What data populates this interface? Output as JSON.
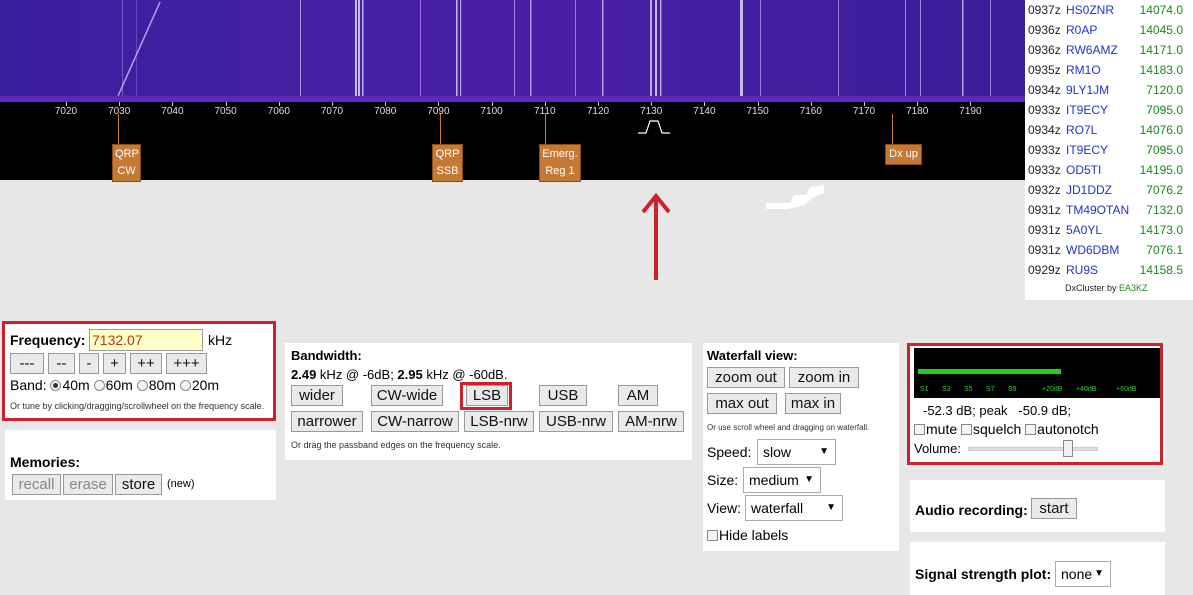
{
  "scale": {
    "ticks": [
      "7020",
      "7030",
      "7040",
      "7050",
      "7060",
      "7070",
      "7080",
      "7090",
      "7100",
      "7110",
      "7120",
      "7130",
      "7140",
      "7150",
      "7160",
      "7170",
      "7180",
      "7190"
    ],
    "labels": [
      {
        "line1": "QRP",
        "line2": "CW"
      },
      {
        "line1": "QRP",
        "line2": "SSB"
      },
      {
        "line1": "Emerg.",
        "line2": "Reg 1"
      },
      {
        "line1": "Dx up",
        "line2": ""
      }
    ]
  },
  "dxcluster": {
    "rows": [
      {
        "time": "0937z",
        "call": "HS0ZNR",
        "freq": "14074.0"
      },
      {
        "time": "0936z",
        "call": "R0AP",
        "freq": "14045.0"
      },
      {
        "time": "0936z",
        "call": "RW6AMZ",
        "freq": "14171.0"
      },
      {
        "time": "0935z",
        "call": "RM1O",
        "freq": "14183.0"
      },
      {
        "time": "0934z",
        "call": "9LY1JM",
        "freq": "7120.0"
      },
      {
        "time": "0933z",
        "call": "IT9ECY",
        "freq": "7095.0"
      },
      {
        "time": "0934z",
        "call": "RO7L",
        "freq": "14076.0"
      },
      {
        "time": "0933z",
        "call": "IT9ECY",
        "freq": "7095.0"
      },
      {
        "time": "0933z",
        "call": "OD5TI",
        "freq": "14195.0"
      },
      {
        "time": "0932z",
        "call": "JD1DDZ",
        "freq": "7076.2"
      },
      {
        "time": "0931z",
        "call": "TM49OTAN",
        "freq": "7132.0"
      },
      {
        "time": "0931z",
        "call": "5A0YL",
        "freq": "14173.0"
      },
      {
        "time": "0931z",
        "call": "WD6DBM",
        "freq": "7076.1"
      },
      {
        "time": "0929z",
        "call": "RU9S",
        "freq": "14158.5"
      }
    ],
    "footer_prefix": "DxCluster by ",
    "footer_link": "EA3KZ"
  },
  "frequency": {
    "label": "Frequency:",
    "value": "7132.07",
    "unit": "kHz",
    "step_buttons": [
      "---",
      "--",
      "-",
      "+",
      "++",
      "+++"
    ],
    "band_label": "Band:",
    "bands": [
      "40m",
      "60m",
      "80m",
      "20m"
    ],
    "selected_band": "40m",
    "hint": "Or tune by clicking/dragging/scrollwheel on the frequency scale."
  },
  "memories": {
    "label": "Memories:",
    "recall": "recall",
    "erase": "erase",
    "store": "store",
    "new": "(new)"
  },
  "bandwidth": {
    "label": "Bandwidth:",
    "bw1": "2.49",
    "bw1_text": " kHz @ -6dB; ",
    "bw2": "2.95",
    "bw2_text": " kHz @ -60dB.",
    "row1": [
      "wider",
      "CW-wide",
      "LSB",
      "USB",
      "AM"
    ],
    "row2": [
      "narrower",
      "CW-narrow",
      "LSB-nrw",
      "USB-nrw",
      "AM-nrw"
    ],
    "hint": "Or drag the passband edges on the frequency scale."
  },
  "waterfall_view": {
    "label": "Waterfall view:",
    "zoom_out": "zoom out",
    "zoom_in": "zoom in",
    "max_out": "max out",
    "max_in": "max in",
    "hint": "Or use scroll wheel and dragging on waterfall.",
    "speed_label": "Speed:",
    "speed": "slow",
    "size_label": "Size:",
    "size": "medium",
    "view_label": "View:",
    "view": "waterfall",
    "hide_labels": "Hide labels"
  },
  "smeter": {
    "scale": [
      "S1",
      "S3",
      "S5",
      "S7",
      "S9",
      "+20dB",
      "+40dB",
      "+60dB"
    ],
    "level_fraction": 0.6,
    "bar_color": "#22cc22",
    "reading": "-52.3 dB; peak   -50.9 dB;",
    "mute": "mute",
    "squelch": "squelch",
    "autonotch": "autonotch",
    "volume_label": "Volume:",
    "volume_fraction": 0.76
  },
  "audio_recording": {
    "label": "Audio recording:",
    "button": "start"
  },
  "signal_plot": {
    "label": "Signal strength plot:",
    "value": "none"
  },
  "colors": {
    "highlight": "#d0202a",
    "waterfall_bg": "#3a1a9a",
    "label_orange": "#c47a35"
  }
}
